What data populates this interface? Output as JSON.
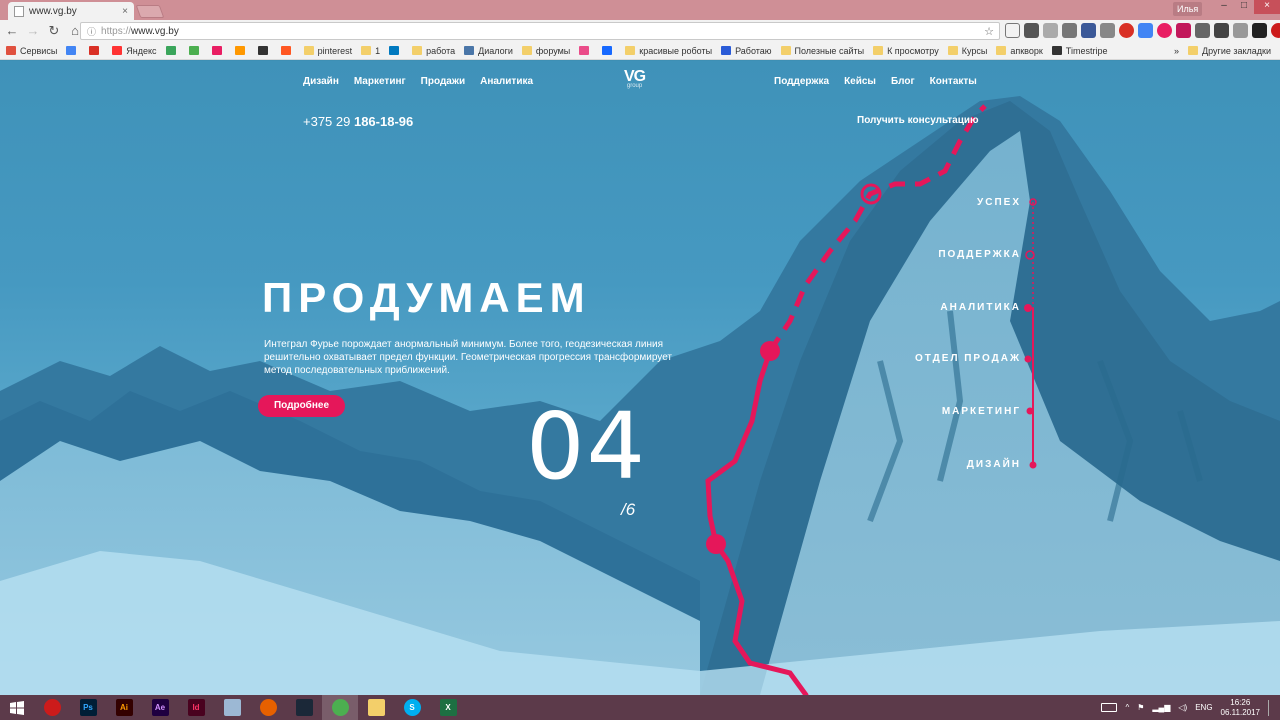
{
  "browser": {
    "tab_title": "www.vg.by",
    "tab_close": "×",
    "profile": "Илья",
    "minimize": "–",
    "maximize": "□",
    "close": "×",
    "back": "←",
    "forward": "→",
    "reload": "↻",
    "home": "⌂",
    "secure_icon": "ⓘ",
    "url_proto": "https://",
    "url_host": "www.vg.by",
    "star": "☆"
  },
  "bookmarks": {
    "items": [
      {
        "label": "Сервисы",
        "color": "#e0513f"
      },
      {
        "label": "",
        "color": "#4285f4"
      },
      {
        "label": "",
        "color": "#d93025"
      },
      {
        "label": "Яндекс",
        "color": "#ff3333"
      },
      {
        "label": "",
        "color": "#3aa55b"
      },
      {
        "label": "",
        "color": "#4caf50"
      },
      {
        "label": "",
        "color": "#e91e63"
      },
      {
        "label": "",
        "color": "#ff9800"
      },
      {
        "label": "",
        "color": "#333333"
      },
      {
        "label": "",
        "color": "#ff5722"
      },
      {
        "label": "pinterest",
        "color": "#f3cf6a"
      },
      {
        "label": "1",
        "color": "#f3cf6a"
      },
      {
        "label": "",
        "color": "#0079bf"
      },
      {
        "label": "работа",
        "color": "#f3cf6a"
      },
      {
        "label": "Диалоги",
        "color": "#4a76a8"
      },
      {
        "label": "форумы",
        "color": "#f3cf6a"
      },
      {
        "label": "",
        "color": "#ea4c89"
      },
      {
        "label": "",
        "color": "#1769ff"
      },
      {
        "label": "красивые роботы",
        "color": "#f3cf6a"
      },
      {
        "label": "Работаю",
        "color": "#2a5bd7"
      },
      {
        "label": "Полезные сайты",
        "color": "#f3cf6a"
      },
      {
        "label": "К просмотру",
        "color": "#f3cf6a"
      },
      {
        "label": "Курсы",
        "color": "#f3cf6a"
      },
      {
        "label": "апкворк",
        "color": "#f3cf6a"
      },
      {
        "label": "Timestripe",
        "color": "#333333"
      }
    ],
    "more": "»",
    "other": "Другие закладки"
  },
  "site": {
    "nav_left": [
      "Дизайн",
      "Маркетинг",
      "Продажи",
      "Аналитика"
    ],
    "nav_right": [
      "Поддержка",
      "Кейсы",
      "Блог",
      "Контакты"
    ],
    "logo": "VG",
    "logo_sub": "group",
    "phone_prefix": "+375 29 ",
    "phone_number": "186-18-96",
    "consult": "Получить консультацию",
    "hero_title": "ПРОДУМАЕМ",
    "hero_text": "Интеграл Фурье порождает анормальный минимум. Более того, геодезическая линия решительно охватывает предел функции. Геометрическая прогрессия трансформирует метод последовательных приближений.",
    "more_button": "Подробнее",
    "counter": "04",
    "counter_total": "/6",
    "steps": [
      "УСПЕХ",
      "ПОДДЕРЖКА",
      "АНАЛИТИКА",
      "ОТДЕЛ ПРОДАЖ",
      "МАРКЕТИНГ",
      "ДИЗАЙН"
    ],
    "accent": "#e5175a"
  },
  "taskbar": {
    "apps": [
      {
        "name": "opera",
        "label": "",
        "bg": "#cc1b1b",
        "fg": "#ffffff",
        "active": false
      },
      {
        "name": "photoshop",
        "label": "Ps",
        "bg": "#001e36",
        "fg": "#31a8ff",
        "active": false
      },
      {
        "name": "illustrator",
        "label": "Ai",
        "bg": "#330000",
        "fg": "#ff9a00",
        "active": false
      },
      {
        "name": "after-effects",
        "label": "Ae",
        "bg": "#1f0040",
        "fg": "#d291ff",
        "active": false
      },
      {
        "name": "indesign",
        "label": "Id",
        "bg": "#49021f",
        "fg": "#ff3366",
        "active": false
      },
      {
        "name": "calculator",
        "label": "",
        "bg": "#9cb8d4",
        "fg": "#ffffff",
        "active": false
      },
      {
        "name": "firefox",
        "label": "",
        "bg": "#e66000",
        "fg": "#ffffff",
        "active": false
      },
      {
        "name": "steam",
        "label": "",
        "bg": "#1b2838",
        "fg": "#ffffff",
        "active": false
      },
      {
        "name": "chrome",
        "label": "",
        "bg": "#4caf50",
        "fg": "#ffffff",
        "active": true
      },
      {
        "name": "explorer",
        "label": "",
        "bg": "#f3cf6a",
        "fg": "#ffffff",
        "active": false
      },
      {
        "name": "skype",
        "label": "S",
        "bg": "#00aff0",
        "fg": "#ffffff",
        "active": false
      },
      {
        "name": "excel",
        "label": "X",
        "bg": "#1d6f42",
        "fg": "#ffffff",
        "active": false
      }
    ],
    "lang": "ENG",
    "time": "16:26",
    "date": "06.11.2017"
  }
}
